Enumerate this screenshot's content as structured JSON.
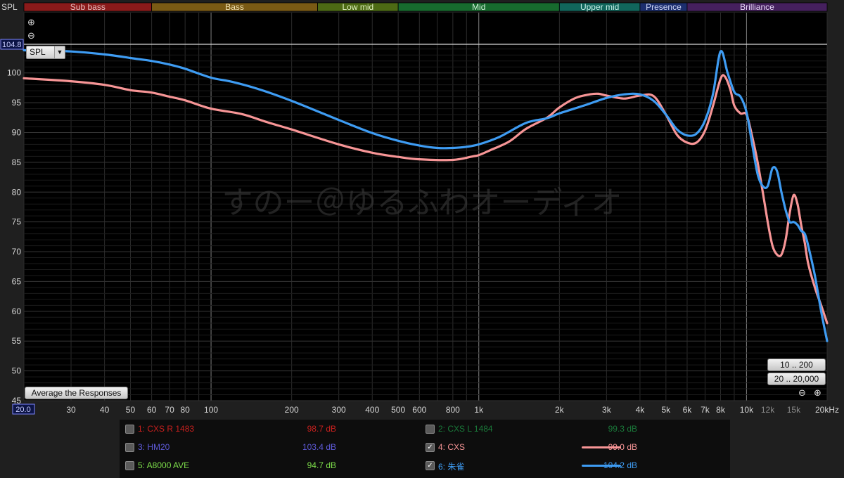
{
  "chart_data": {
    "type": "line",
    "ylabel": "SPL",
    "ylim": [
      45,
      104.8
    ],
    "xlim": [
      20,
      20000
    ],
    "x_scale": "log",
    "grid": true,
    "cursor_value_label": "104.8",
    "x_start_label": "20.0",
    "y_ticks": [
      100,
      95,
      90,
      85,
      80,
      75,
      70,
      65,
      60,
      55,
      50,
      45
    ],
    "x_ticks": [
      {
        "v": 30,
        "t": "30",
        "c": "#d6d6d6"
      },
      {
        "v": 40,
        "t": "40",
        "c": "#d6d6d6"
      },
      {
        "v": 50,
        "t": "50",
        "c": "#d6d6d6"
      },
      {
        "v": 60,
        "t": "60",
        "c": "#d6d6d6"
      },
      {
        "v": 70,
        "t": "70",
        "c": "#d6d6d6"
      },
      {
        "v": 80,
        "t": "80",
        "c": "#d6d6d6"
      },
      {
        "v": 100,
        "t": "100",
        "c": "#d6d6d6"
      },
      {
        "v": 200,
        "t": "200",
        "c": "#d6d6d6"
      },
      {
        "v": 300,
        "t": "300",
        "c": "#d6d6d6"
      },
      {
        "v": 400,
        "t": "400",
        "c": "#d6d6d6"
      },
      {
        "v": 500,
        "t": "500",
        "c": "#d6d6d6"
      },
      {
        "v": 600,
        "t": "600",
        "c": "#d6d6d6"
      },
      {
        "v": 800,
        "t": "800",
        "c": "#d6d6d6"
      },
      {
        "v": 1000,
        "t": "1k",
        "c": "#d6d6d6"
      },
      {
        "v": 2000,
        "t": "2k",
        "c": "#d6d6d6"
      },
      {
        "v": 3000,
        "t": "3k",
        "c": "#d6d6d6"
      },
      {
        "v": 4000,
        "t": "4k",
        "c": "#d6d6d6"
      },
      {
        "v": 5000,
        "t": "5k",
        "c": "#d6d6d6"
      },
      {
        "v": 6000,
        "t": "6k",
        "c": "#d6d6d6"
      },
      {
        "v": 7000,
        "t": "7k",
        "c": "#d6d6d6"
      },
      {
        "v": 8000,
        "t": "8k",
        "c": "#d6d6d6"
      },
      {
        "v": 10000,
        "t": "10k",
        "c": "#d6d6d6"
      },
      {
        "v": 12000,
        "t": "12k",
        "c": "#8a8a8a"
      },
      {
        "v": 15000,
        "t": "15k",
        "c": "#8a8a8a"
      },
      {
        "v": 20000,
        "t": "20kHz",
        "c": "#d6d6d6"
      }
    ],
    "bands": [
      {
        "name": "Sub bass",
        "from": 20,
        "to": 60,
        "color": "#8b1a1a",
        "text": "#e8c0c0"
      },
      {
        "name": "Bass",
        "from": 60,
        "to": 250,
        "color": "#7a5a14",
        "text": "#f0e0b0"
      },
      {
        "name": "Low mid",
        "from": 250,
        "to": 500,
        "color": "#4d6a14",
        "text": "#e0f0c0"
      },
      {
        "name": "Mid",
        "from": 500,
        "to": 2000,
        "color": "#176b2e",
        "text": "#d0f0d8"
      },
      {
        "name": "Upper mid",
        "from": 2000,
        "to": 4000,
        "color": "#11665c",
        "text": "#c8f0e8"
      },
      {
        "name": "Presence",
        "from": 4000,
        "to": 6000,
        "color": "#1c2e6e",
        "text": "#d0d8f8"
      },
      {
        "name": "Brilliance",
        "from": 6000,
        "to": 20000,
        "color": "#45205e",
        "text": "#e8d8f8"
      }
    ],
    "watermark": "すのー＠ゆるふわオーディオ",
    "series": [
      {
        "name": "CXS",
        "color": "#f79596",
        "x": [
          20,
          30,
          40,
          50,
          60,
          70,
          80,
          100,
          130,
          160,
          200,
          300,
          400,
          500,
          600,
          800,
          950,
          1000,
          1100,
          1300,
          1500,
          1800,
          2000,
          2300,
          2600,
          2800,
          3000,
          3500,
          4000,
          4500,
          5000,
          5500,
          6000,
          6500,
          7000,
          7500,
          8000,
          8300,
          8700,
          9000,
          9500,
          10000,
          10500,
          11000,
          11500,
          12000,
          12500,
          13000,
          13500,
          14000,
          14500,
          15000,
          15500,
          16000,
          16500,
          17000,
          18000,
          19000,
          20000
        ],
        "values": [
          99.1,
          98.6,
          98.0,
          97.1,
          96.7,
          96.0,
          95.4,
          94.0,
          93.1,
          91.8,
          90.5,
          88.0,
          86.6,
          85.9,
          85.5,
          85.4,
          86.0,
          86.2,
          87.0,
          88.5,
          90.6,
          92.5,
          94.2,
          95.8,
          96.4,
          96.5,
          96.2,
          95.7,
          96.2,
          96.1,
          93.0,
          89.6,
          88.3,
          88.3,
          90.3,
          94.5,
          99.0,
          99.4,
          97.2,
          94.5,
          93.2,
          93.0,
          89.3,
          85.0,
          80.0,
          75.0,
          71.0,
          69.5,
          69.5,
          72.0,
          76.5,
          79.5,
          78.0,
          74.5,
          71.5,
          68.0,
          64.0,
          61.0,
          58.0
        ]
      },
      {
        "name": "朱雀",
        "color": "#3e9cf3",
        "x": [
          20,
          30,
          40,
          50,
          60,
          70,
          80,
          100,
          120,
          150,
          200,
          300,
          400,
          500,
          600,
          700,
          800,
          900,
          1000,
          1200,
          1500,
          1800,
          2000,
          2500,
          3000,
          3500,
          4000,
          4500,
          5000,
          5500,
          6000,
          6500,
          7000,
          7500,
          8000,
          8500,
          9000,
          9500,
          10000,
          10500,
          11000,
          11500,
          12000,
          12500,
          13000,
          13500,
          14000,
          14500,
          15000,
          15500,
          16000,
          16500,
          17000,
          18000,
          19000,
          20000
        ],
        "values": [
          103.8,
          103.6,
          103.1,
          102.5,
          102.0,
          101.4,
          100.7,
          99.2,
          98.5,
          97.3,
          95.3,
          92.1,
          89.9,
          88.6,
          87.8,
          87.4,
          87.4,
          87.6,
          88.0,
          89.3,
          91.6,
          92.4,
          93.2,
          94.6,
          95.8,
          96.4,
          96.4,
          95.3,
          93.0,
          90.5,
          89.5,
          89.8,
          92.0,
          96.5,
          103.6,
          100.0,
          96.8,
          96.0,
          93.4,
          88.0,
          83.0,
          81.0,
          81.0,
          84.0,
          83.5,
          80.0,
          77.0,
          75.0,
          75.0,
          74.5,
          73.5,
          73.0,
          71.0,
          66.0,
          60.0,
          55.0
        ]
      }
    ]
  },
  "buttons": {
    "average_label": "Average the Responses",
    "range_10_200": "10 .. 200",
    "range_20_20000": "20 .. 20,000",
    "spl_select": "SPL",
    "zoom_in": "⊕",
    "zoom_out": "⊖"
  },
  "legend": [
    {
      "label": "1: CXS R 1483",
      "value": "98.7 dB",
      "checked": false,
      "color": "#c8201e",
      "show_line": false
    },
    {
      "label": "2: CXS L 1484",
      "value": "99.3 dB",
      "checked": false,
      "color": "#1a7a3a",
      "show_line": false
    },
    {
      "label": "3: HM20",
      "value": "103.4 dB",
      "checked": false,
      "color": "#5e5ad8",
      "show_line": false
    },
    {
      "label": "4: CXS",
      "value": "99.0 dB",
      "checked": true,
      "color": "#f79596",
      "show_line": true
    },
    {
      "label": "5: A8000 AVE",
      "value": "94.7 dB",
      "checked": false,
      "color": "#7cdc4a",
      "show_line": false
    },
    {
      "label": "6: 朱雀",
      "value": "104.2 dB",
      "checked": true,
      "color": "#3e9cf3",
      "show_line": true
    }
  ]
}
